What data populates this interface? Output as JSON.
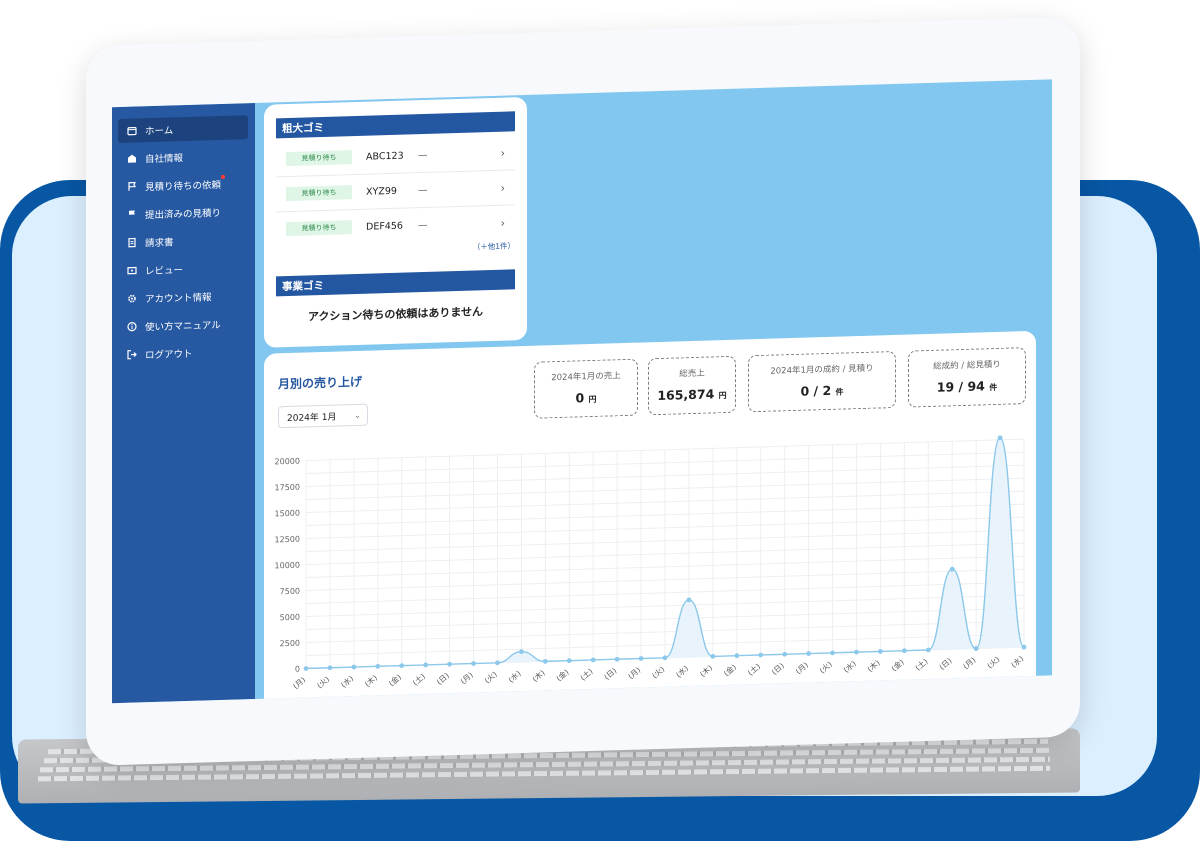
{
  "sidebar": {
    "items": [
      {
        "label": "ホーム",
        "icon": "home-icon",
        "active": true
      },
      {
        "label": "自社情報",
        "icon": "building-icon"
      },
      {
        "label": "見積り待ちの依頼",
        "icon": "flag-outline-icon",
        "has_notification": true
      },
      {
        "label": "提出済みの見積り",
        "icon": "flag-icon"
      },
      {
        "label": "請求書",
        "icon": "document-icon"
      },
      {
        "label": "レビュー",
        "icon": "review-icon"
      },
      {
        "label": "アカウント情報",
        "icon": "gear-icon"
      },
      {
        "label": "使い方マニュアル",
        "icon": "info-icon"
      },
      {
        "label": "ログアウト",
        "icon": "logout-icon"
      }
    ]
  },
  "sodai_gomi": {
    "title": "粗大ゴミ",
    "requests": [
      {
        "status": "見積り待ち",
        "id": "ABC123",
        "detail": "—"
      },
      {
        "status": "見積り待ち",
        "id": "XYZ99",
        "detail": "—"
      },
      {
        "status": "見積り待ち",
        "id": "DEF456",
        "detail": "—"
      }
    ],
    "more_link": "（＋他1件）"
  },
  "jigyo_gomi": {
    "title": "事業ゴミ",
    "empty_message": "アクション待ちの依頼はありません"
  },
  "sales": {
    "title": "月別の売り上げ",
    "month_select": "2024年 1月",
    "stats": [
      {
        "label": "2024年1月の売上",
        "value": "0",
        "unit": "円"
      },
      {
        "label": "総売上",
        "value": "165,874",
        "unit": "円"
      },
      {
        "label": "2024年1月の成約 / 見積り",
        "value": "0 / 2",
        "unit": "件"
      },
      {
        "label": "総成約 / 総見積り",
        "value": "19 / 94",
        "unit": "件"
      }
    ]
  },
  "chart_data": {
    "type": "area",
    "y_ticks": [
      "20000",
      "17500",
      "15000",
      "12500",
      "10000",
      "7500",
      "5000",
      "2500",
      "0"
    ],
    "ylim": [
      0,
      20000
    ],
    "x": [
      1,
      2,
      3,
      4,
      5,
      6,
      7,
      8,
      9,
      10,
      11,
      12,
      13,
      14,
      15,
      16,
      17,
      18,
      19,
      20,
      21,
      22,
      23,
      24,
      25,
      26,
      27,
      28,
      29,
      30,
      31
    ],
    "values": [
      0,
      0,
      0,
      0,
      0,
      0,
      0,
      0,
      0,
      1000,
      0,
      0,
      0,
      0,
      0,
      0,
      5500,
      0,
      0,
      0,
      0,
      0,
      0,
      0,
      0,
      0,
      0,
      7700,
      0,
      20200,
      0
    ],
    "x_tick_labels": [
      "(月)",
      "(火)",
      "(水)",
      "(木)",
      "(金)",
      "(土)",
      "(日)",
      "(月)",
      "(火)",
      "(水)",
      "(木)",
      "(金)",
      "(土)",
      "(日)",
      "(月)",
      "(火)",
      "(水)",
      "(木)",
      "(金)",
      "(土)",
      "(日)",
      "(月)",
      "(火)",
      "(水)",
      "(木)",
      "(金)",
      "(土)",
      "(日)",
      "(月)",
      "(火)",
      "(水)"
    ],
    "grid": true,
    "color": "#8cc8ea"
  }
}
